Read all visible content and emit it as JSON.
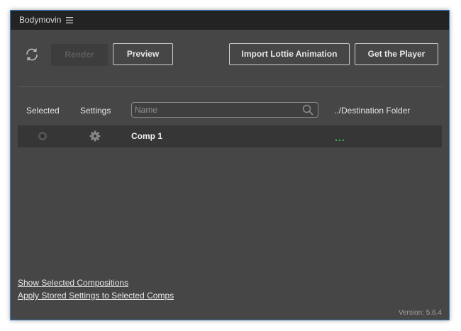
{
  "window": {
    "title": "Bodymovin"
  },
  "toolbar": {
    "render_label": "Render",
    "preview_label": "Preview",
    "import_label": "Import Lottie Animation",
    "player_label": "Get the Player"
  },
  "columns": {
    "selected": "Selected",
    "settings": "Settings",
    "destination": "../Destination Folder"
  },
  "search": {
    "placeholder": "Name",
    "value": ""
  },
  "compositions": [
    {
      "name": "Comp 1",
      "selected": false,
      "destination": "..."
    }
  ],
  "footer": {
    "show_selected": "Show Selected Compositions",
    "apply_settings": "Apply Stored Settings to Selected Comps",
    "version": "Version: 5.6.4"
  },
  "icons": {
    "refresh": "refresh-icon",
    "menu": "hamburger-menu-icon",
    "search": "search-icon",
    "gear": "gear-icon",
    "radio": "radio-icon"
  },
  "colors": {
    "panel_bg": "#464646",
    "titlebar_bg": "#232323",
    "row_bg": "#363636",
    "accent_border": "#3a7ec0",
    "destination_dots": "#2ecc40"
  }
}
